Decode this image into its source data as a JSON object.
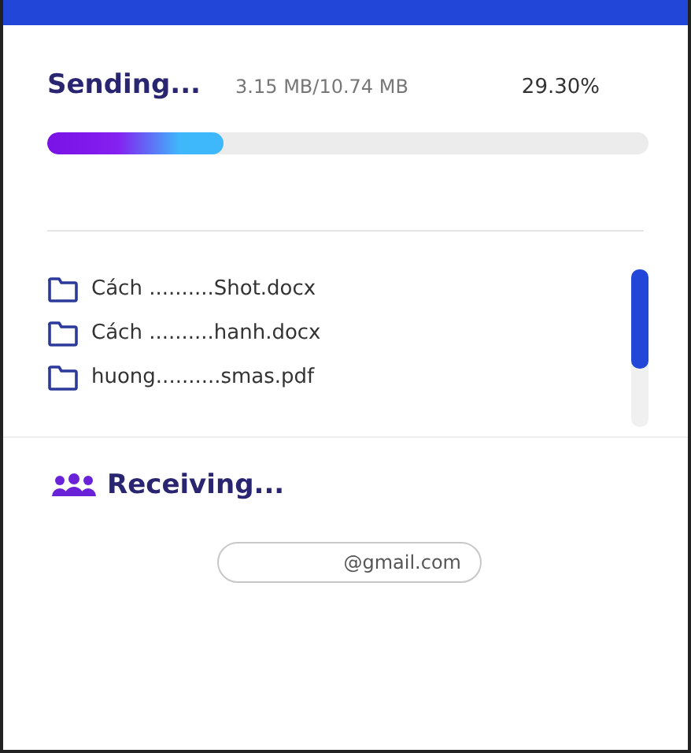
{
  "sending": {
    "title": "Sending...",
    "size": "3.15 MB/10.74 MB",
    "percent": "29.30%",
    "level": 0.293
  },
  "files": [
    {
      "name": "Cách ..........Shot.docx"
    },
    {
      "name": "Cách ..........hanh.docx"
    },
    {
      "name": "huong..........smas.pdf"
    }
  ],
  "receiving": {
    "title": "Receiving...",
    "email": "@gmail.com"
  }
}
